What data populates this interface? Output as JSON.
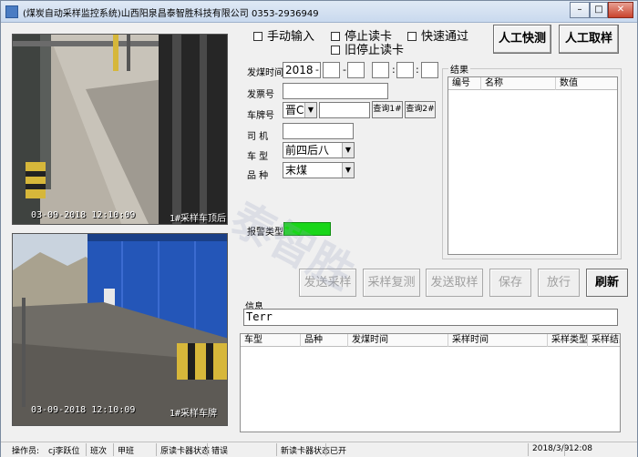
{
  "window": {
    "title": "(煤炭自动采样监控系统)山西阳泉昌泰智胜科技有限公司 0353-2936949",
    "minimize": "–",
    "maximize": "□",
    "close": "✕"
  },
  "cameras": [
    {
      "timestamp": "03-09-2018  12:10:09",
      "caption": "1#采样车顶后"
    },
    {
      "timestamp": "03-09-2018  12:10:09",
      "caption": "1#采样车牌"
    }
  ],
  "options": {
    "manual_input": "手动输入",
    "stop_read_card": "停止读卡",
    "fast_pass": "快速通过",
    "old_stop_read_card": "旧停止读卡"
  },
  "buttons": {
    "manual_quick_sample": "人工快测",
    "manual_sample": "人工取样",
    "query1": "查询1#",
    "query2": "查询2#",
    "send_sample": "发送采样",
    "sample_retest": "采样复测",
    "send_take_sample": "发送取样",
    "save": "保存",
    "release": "放行",
    "refresh": "刷新"
  },
  "form": {
    "ticket_time_label": "发煤时间",
    "ticket_time_year": "2018",
    "ticket_time_sep1": "-",
    "ticket_time_sep2": "-",
    "ticket_time_colon1": ":",
    "ticket_time_colon2": ":",
    "ticket_no_label": "发票号",
    "plate_label": "车牌号",
    "plate_prefix": "晋C",
    "driver_label": "司    机",
    "vehicle_type_label": "车    型",
    "vehicle_type_value": "前四后八",
    "product_label": "品    种",
    "product_value": "末煤",
    "alarm_type_label": "报警类型"
  },
  "results": {
    "legend": "结果",
    "columns": [
      "编号",
      "名称",
      "数值"
    ]
  },
  "info": {
    "legend": "信息",
    "text": "Terr"
  },
  "records": {
    "columns": [
      "车型",
      "品种",
      "发煤时间",
      "采样时间",
      "采样类型",
      "采样结果"
    ]
  },
  "status": {
    "operator_label": "操作员:",
    "operator_value": "cj李跃位",
    "shift_label": "班次",
    "shift_value": "甲班",
    "reader_label": "原读卡器状态",
    "reader_value": "错误",
    "new_reader_label": "新读卡器状态",
    "new_reader_value": "已开",
    "date": "2018/3/9",
    "time": "12:08"
  },
  "watermark": "泰智胜",
  "colors": {
    "alarm_indicator": "#19d619"
  }
}
